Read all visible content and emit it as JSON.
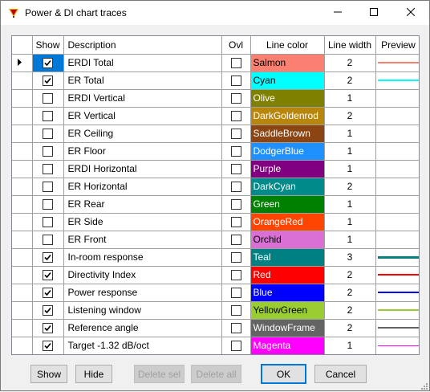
{
  "window": {
    "title": "Power & DI chart traces"
  },
  "grid": {
    "columns": {
      "show": "Show",
      "description": "Description",
      "ovl": "Ovl",
      "line_color": "Line color",
      "line_width": "Line width",
      "preview": "Preview"
    },
    "rows": [
      {
        "show": true,
        "description": "ERDI Total",
        "ovl": false,
        "color_name": "Salmon",
        "color": "#fa8072",
        "text_color": "#000000",
        "width": "2",
        "preview": true,
        "selected": true
      },
      {
        "show": true,
        "description": "ER Total",
        "ovl": false,
        "color_name": "Cyan",
        "color": "#00ffff",
        "text_color": "#000000",
        "width": "2",
        "preview": true,
        "selected": false
      },
      {
        "show": false,
        "description": "ERDI Vertical",
        "ovl": false,
        "color_name": "Olive",
        "color": "#808000",
        "text_color": "#ffffff",
        "width": "1",
        "preview": false,
        "selected": false
      },
      {
        "show": false,
        "description": "ER Vertical",
        "ovl": false,
        "color_name": "DarkGoldenrod",
        "color": "#b8860b",
        "text_color": "#ffffff",
        "width": "2",
        "preview": false,
        "selected": false
      },
      {
        "show": false,
        "description": "ER Ceiling",
        "ovl": false,
        "color_name": "SaddleBrown",
        "color": "#8b4513",
        "text_color": "#ffffff",
        "width": "1",
        "preview": false,
        "selected": false
      },
      {
        "show": false,
        "description": "ER Floor",
        "ovl": false,
        "color_name": "DodgerBlue",
        "color": "#1e90ff",
        "text_color": "#ffffff",
        "width": "1",
        "preview": false,
        "selected": false
      },
      {
        "show": false,
        "description": "ERDI Horizontal",
        "ovl": false,
        "color_name": "Purple",
        "color": "#800080",
        "text_color": "#ffffff",
        "width": "1",
        "preview": false,
        "selected": false
      },
      {
        "show": false,
        "description": "ER Horizontal",
        "ovl": false,
        "color_name": "DarkCyan",
        "color": "#008b8b",
        "text_color": "#ffffff",
        "width": "2",
        "preview": false,
        "selected": false
      },
      {
        "show": false,
        "description": "ER Rear",
        "ovl": false,
        "color_name": "Green",
        "color": "#008000",
        "text_color": "#ffffff",
        "width": "1",
        "preview": false,
        "selected": false
      },
      {
        "show": false,
        "description": "ER Side",
        "ovl": false,
        "color_name": "OrangeRed",
        "color": "#ff4500",
        "text_color": "#ffffff",
        "width": "1",
        "preview": false,
        "selected": false
      },
      {
        "show": false,
        "description": "ER Front",
        "ovl": false,
        "color_name": "Orchid",
        "color": "#da70d6",
        "text_color": "#000000",
        "width": "1",
        "preview": false,
        "selected": false
      },
      {
        "show": true,
        "description": "In-room response",
        "ovl": false,
        "color_name": "Teal",
        "color": "#008080",
        "text_color": "#ffffff",
        "width": "3",
        "preview": true,
        "selected": false
      },
      {
        "show": true,
        "description": "Directivity Index",
        "ovl": false,
        "color_name": "Red",
        "color": "#ff0000",
        "text_color": "#ffffff",
        "width": "2",
        "preview": true,
        "selected": false
      },
      {
        "show": true,
        "description": "Power response",
        "ovl": false,
        "color_name": "Blue",
        "color": "#0000ff",
        "text_color": "#ffffff",
        "width": "2",
        "preview": true,
        "selected": false
      },
      {
        "show": true,
        "description": "Listening window",
        "ovl": false,
        "color_name": "YellowGreen",
        "color": "#9acd32",
        "text_color": "#000000",
        "width": "2",
        "preview": true,
        "selected": false
      },
      {
        "show": true,
        "description": "Reference angle",
        "ovl": false,
        "color_name": "WindowFrame",
        "color": "#646464",
        "text_color": "#ffffff",
        "width": "2",
        "preview": true,
        "selected": false
      },
      {
        "show": true,
        "description": "Target -1.32 dB/oct",
        "ovl": false,
        "color_name": "Magenta",
        "color": "#ff00ff",
        "text_color": "#ffffff",
        "width": "1",
        "preview": true,
        "selected": false
      }
    ]
  },
  "buttons": {
    "show": "Show",
    "hide": "Hide",
    "delete_sel": "Delete sel",
    "delete_all": "Delete all",
    "ok": "OK",
    "cancel": "Cancel"
  },
  "icons": {
    "app": "app-icon",
    "minimize": "minimize-icon",
    "maximize": "maximize-icon",
    "close": "close-icon",
    "row_pointer": "row-pointer-icon",
    "checkmark": "checkmark-icon",
    "resize_grip": "resize-grip-icon"
  },
  "colors": {
    "selection": "#0078d7",
    "grid_line": "#a0a0a0"
  }
}
